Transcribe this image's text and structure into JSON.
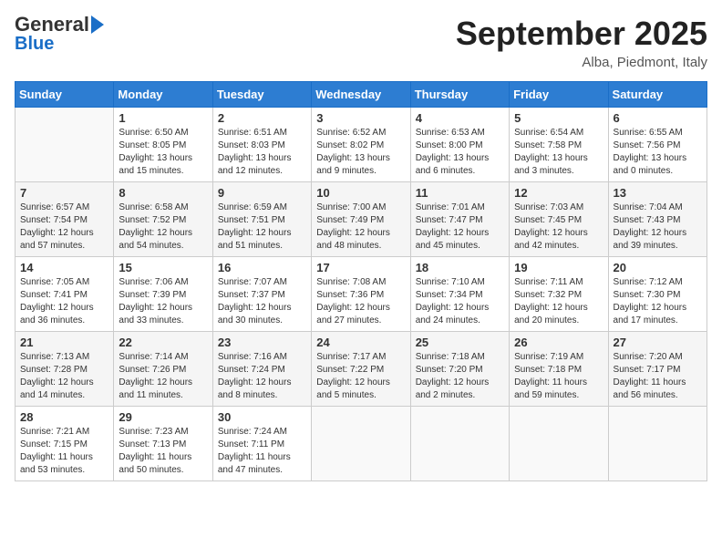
{
  "header": {
    "logo_general": "General",
    "logo_blue": "Blue",
    "title": "September 2025",
    "location": "Alba, Piedmont, Italy"
  },
  "weekdays": [
    "Sunday",
    "Monday",
    "Tuesday",
    "Wednesday",
    "Thursday",
    "Friday",
    "Saturday"
  ],
  "weeks": [
    [
      {
        "day": "",
        "sunrise": "",
        "sunset": "",
        "daylight": ""
      },
      {
        "day": "1",
        "sunrise": "Sunrise: 6:50 AM",
        "sunset": "Sunset: 8:05 PM",
        "daylight": "Daylight: 13 hours and 15 minutes."
      },
      {
        "day": "2",
        "sunrise": "Sunrise: 6:51 AM",
        "sunset": "Sunset: 8:03 PM",
        "daylight": "Daylight: 13 hours and 12 minutes."
      },
      {
        "day": "3",
        "sunrise": "Sunrise: 6:52 AM",
        "sunset": "Sunset: 8:02 PM",
        "daylight": "Daylight: 13 hours and 9 minutes."
      },
      {
        "day": "4",
        "sunrise": "Sunrise: 6:53 AM",
        "sunset": "Sunset: 8:00 PM",
        "daylight": "Daylight: 13 hours and 6 minutes."
      },
      {
        "day": "5",
        "sunrise": "Sunrise: 6:54 AM",
        "sunset": "Sunset: 7:58 PM",
        "daylight": "Daylight: 13 hours and 3 minutes."
      },
      {
        "day": "6",
        "sunrise": "Sunrise: 6:55 AM",
        "sunset": "Sunset: 7:56 PM",
        "daylight": "Daylight: 13 hours and 0 minutes."
      }
    ],
    [
      {
        "day": "7",
        "sunrise": "Sunrise: 6:57 AM",
        "sunset": "Sunset: 7:54 PM",
        "daylight": "Daylight: 12 hours and 57 minutes."
      },
      {
        "day": "8",
        "sunrise": "Sunrise: 6:58 AM",
        "sunset": "Sunset: 7:52 PM",
        "daylight": "Daylight: 12 hours and 54 minutes."
      },
      {
        "day": "9",
        "sunrise": "Sunrise: 6:59 AM",
        "sunset": "Sunset: 7:51 PM",
        "daylight": "Daylight: 12 hours and 51 minutes."
      },
      {
        "day": "10",
        "sunrise": "Sunrise: 7:00 AM",
        "sunset": "Sunset: 7:49 PM",
        "daylight": "Daylight: 12 hours and 48 minutes."
      },
      {
        "day": "11",
        "sunrise": "Sunrise: 7:01 AM",
        "sunset": "Sunset: 7:47 PM",
        "daylight": "Daylight: 12 hours and 45 minutes."
      },
      {
        "day": "12",
        "sunrise": "Sunrise: 7:03 AM",
        "sunset": "Sunset: 7:45 PM",
        "daylight": "Daylight: 12 hours and 42 minutes."
      },
      {
        "day": "13",
        "sunrise": "Sunrise: 7:04 AM",
        "sunset": "Sunset: 7:43 PM",
        "daylight": "Daylight: 12 hours and 39 minutes."
      }
    ],
    [
      {
        "day": "14",
        "sunrise": "Sunrise: 7:05 AM",
        "sunset": "Sunset: 7:41 PM",
        "daylight": "Daylight: 12 hours and 36 minutes."
      },
      {
        "day": "15",
        "sunrise": "Sunrise: 7:06 AM",
        "sunset": "Sunset: 7:39 PM",
        "daylight": "Daylight: 12 hours and 33 minutes."
      },
      {
        "day": "16",
        "sunrise": "Sunrise: 7:07 AM",
        "sunset": "Sunset: 7:37 PM",
        "daylight": "Daylight: 12 hours and 30 minutes."
      },
      {
        "day": "17",
        "sunrise": "Sunrise: 7:08 AM",
        "sunset": "Sunset: 7:36 PM",
        "daylight": "Daylight: 12 hours and 27 minutes."
      },
      {
        "day": "18",
        "sunrise": "Sunrise: 7:10 AM",
        "sunset": "Sunset: 7:34 PM",
        "daylight": "Daylight: 12 hours and 24 minutes."
      },
      {
        "day": "19",
        "sunrise": "Sunrise: 7:11 AM",
        "sunset": "Sunset: 7:32 PM",
        "daylight": "Daylight: 12 hours and 20 minutes."
      },
      {
        "day": "20",
        "sunrise": "Sunrise: 7:12 AM",
        "sunset": "Sunset: 7:30 PM",
        "daylight": "Daylight: 12 hours and 17 minutes."
      }
    ],
    [
      {
        "day": "21",
        "sunrise": "Sunrise: 7:13 AM",
        "sunset": "Sunset: 7:28 PM",
        "daylight": "Daylight: 12 hours and 14 minutes."
      },
      {
        "day": "22",
        "sunrise": "Sunrise: 7:14 AM",
        "sunset": "Sunset: 7:26 PM",
        "daylight": "Daylight: 12 hours and 11 minutes."
      },
      {
        "day": "23",
        "sunrise": "Sunrise: 7:16 AM",
        "sunset": "Sunset: 7:24 PM",
        "daylight": "Daylight: 12 hours and 8 minutes."
      },
      {
        "day": "24",
        "sunrise": "Sunrise: 7:17 AM",
        "sunset": "Sunset: 7:22 PM",
        "daylight": "Daylight: 12 hours and 5 minutes."
      },
      {
        "day": "25",
        "sunrise": "Sunrise: 7:18 AM",
        "sunset": "Sunset: 7:20 PM",
        "daylight": "Daylight: 12 hours and 2 minutes."
      },
      {
        "day": "26",
        "sunrise": "Sunrise: 7:19 AM",
        "sunset": "Sunset: 7:18 PM",
        "daylight": "Daylight: 11 hours and 59 minutes."
      },
      {
        "day": "27",
        "sunrise": "Sunrise: 7:20 AM",
        "sunset": "Sunset: 7:17 PM",
        "daylight": "Daylight: 11 hours and 56 minutes."
      }
    ],
    [
      {
        "day": "28",
        "sunrise": "Sunrise: 7:21 AM",
        "sunset": "Sunset: 7:15 PM",
        "daylight": "Daylight: 11 hours and 53 minutes."
      },
      {
        "day": "29",
        "sunrise": "Sunrise: 7:23 AM",
        "sunset": "Sunset: 7:13 PM",
        "daylight": "Daylight: 11 hours and 50 minutes."
      },
      {
        "day": "30",
        "sunrise": "Sunrise: 7:24 AM",
        "sunset": "Sunset: 7:11 PM",
        "daylight": "Daylight: 11 hours and 47 minutes."
      },
      {
        "day": "",
        "sunrise": "",
        "sunset": "",
        "daylight": ""
      },
      {
        "day": "",
        "sunrise": "",
        "sunset": "",
        "daylight": ""
      },
      {
        "day": "",
        "sunrise": "",
        "sunset": "",
        "daylight": ""
      },
      {
        "day": "",
        "sunrise": "",
        "sunset": "",
        "daylight": ""
      }
    ]
  ]
}
